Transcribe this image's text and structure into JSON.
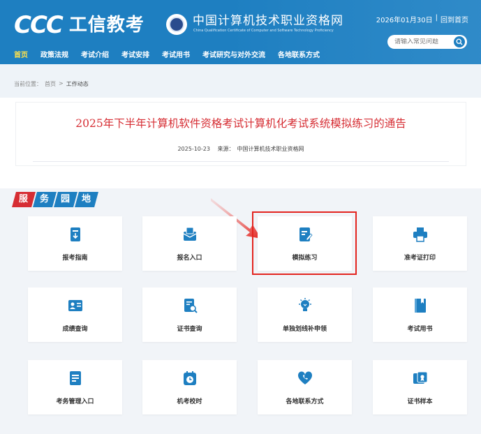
{
  "header": {
    "logo_text": "CCC",
    "logo_cn": "工信教考",
    "site_title": "中国计算机技术职业资格网",
    "site_subtitle": "China Qualification Certificate of Computer and Software Technology Proficiency",
    "date": "2026年01月30日",
    "separator": "|",
    "home_link": "回到首页",
    "search_placeholder": "请输入常见问题"
  },
  "nav": [
    {
      "label": "首页"
    },
    {
      "label": "政策法规"
    },
    {
      "label": "考试介绍"
    },
    {
      "label": "考试安排"
    },
    {
      "label": "考试用书"
    },
    {
      "label": "考试研究与对外交流"
    },
    {
      "label": "各地联系方式"
    }
  ],
  "breadcrumb": {
    "prefix": "当前位置：",
    "home": "首页",
    "sep": ">",
    "current": "工作动态"
  },
  "article": {
    "title": "2025年下半年计算机软件资格考试计算机化考试系统模拟练习的通告",
    "date": "2025-10-23",
    "source_label": "来源：",
    "source": "中国计算机技术职业资格网"
  },
  "service": {
    "tag": [
      "服",
      "务",
      "园",
      "地"
    ],
    "items": [
      {
        "label": "报考指南",
        "icon": "guide-icon"
      },
      {
        "label": "报名入口",
        "icon": "register-icon"
      },
      {
        "label": "模拟练习",
        "icon": "practice-icon"
      },
      {
        "label": "准考证打印",
        "icon": "printer-icon"
      },
      {
        "label": "成绩查询",
        "icon": "score-icon"
      },
      {
        "label": "证书查询",
        "icon": "certificate-search-icon"
      },
      {
        "label": "单独划线补申领",
        "icon": "lightbulb-icon"
      },
      {
        "label": "考试用书",
        "icon": "book-icon"
      },
      {
        "label": "考务管理入口",
        "icon": "exam-admin-icon"
      },
      {
        "label": "机考校时",
        "icon": "clock-icon"
      },
      {
        "label": "各地联系方式",
        "icon": "phone-icon"
      },
      {
        "label": "证书样本",
        "icon": "certificate-sample-icon"
      }
    ]
  },
  "colors": {
    "brand_blue": "#1e7fc1",
    "title_red": "#d62d33",
    "highlight_red": "#e3241f",
    "nav_active": "#ffe14a"
  }
}
